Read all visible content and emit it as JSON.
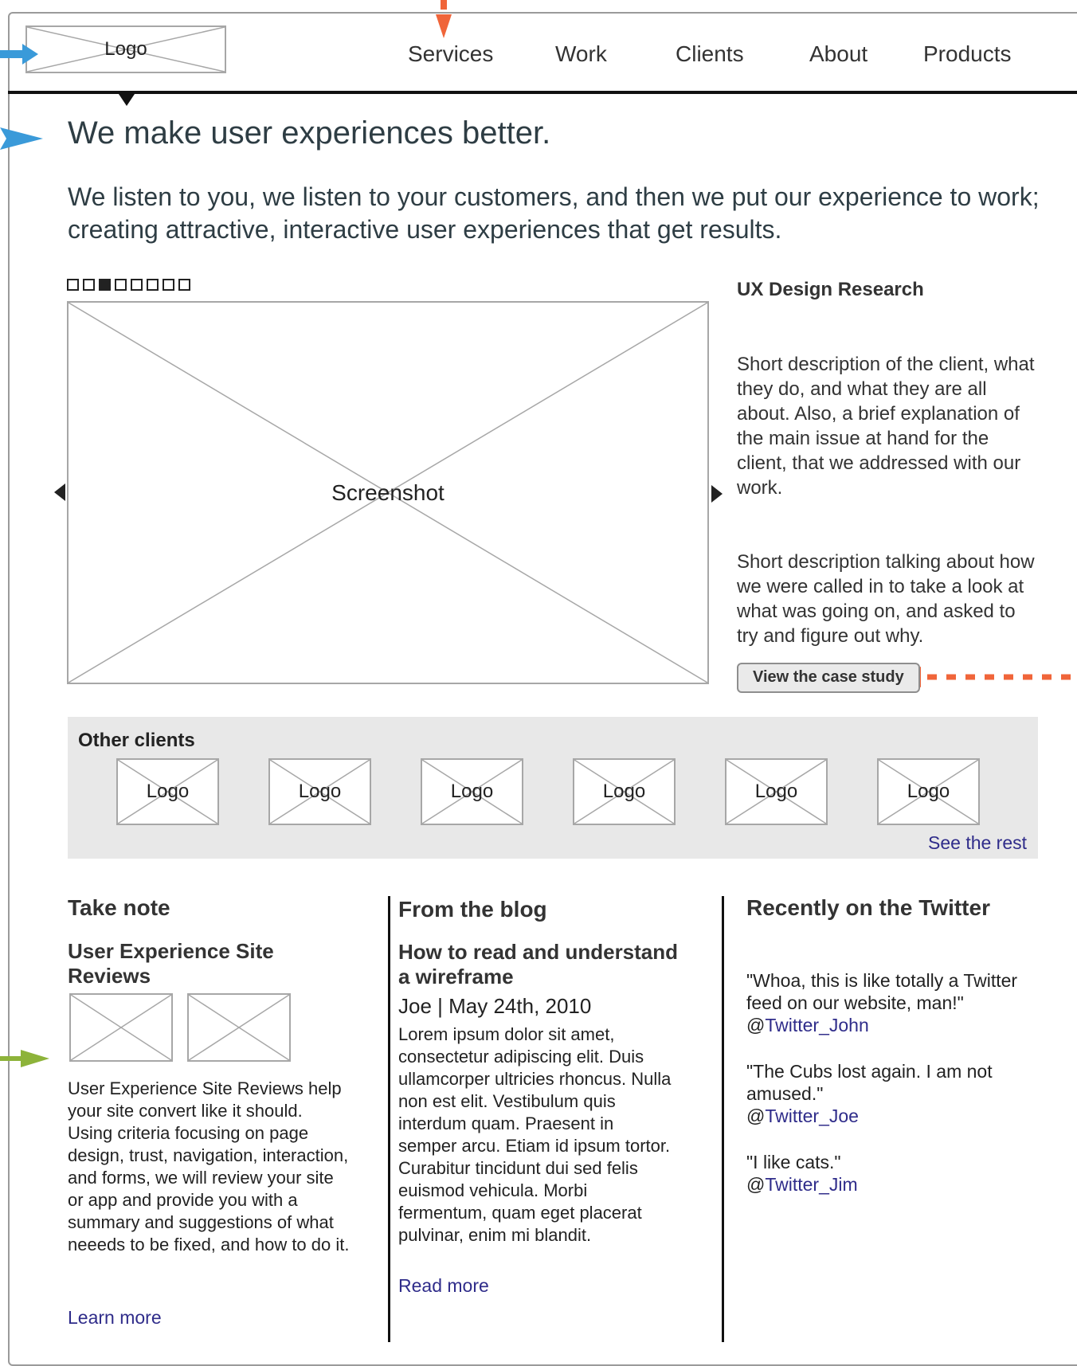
{
  "header": {
    "logo_label": "Logo",
    "nav": [
      "Services",
      "Work",
      "Clients",
      "About",
      "Products"
    ]
  },
  "hero": {
    "title": "We make user experiences better.",
    "intro": "We listen to you, we listen to your customers, and then we put our experience to work; creating attractive, interactive user experiences that get results."
  },
  "carousel": {
    "slide_count": 8,
    "active_index": 2,
    "screenshot_label": "Screenshot"
  },
  "feature": {
    "title": "UX Design Research",
    "description_1": "Short description of the client, what they do, and what they are all about. Also, a brief explanation of the main issue at hand for the client, that we addressed with our work.",
    "description_2": "Short description talking about how we were called in to take a look at what was going on, and asked to try and figure out why.",
    "button_label": "View the case study"
  },
  "other_clients": {
    "title": "Other clients",
    "logos": [
      "Logo",
      "Logo",
      "Logo",
      "Logo",
      "Logo",
      "Logo"
    ],
    "see_rest": "See the rest"
  },
  "take_note": {
    "heading": "Take note",
    "subheading": "User Experience Site Reviews",
    "body": "User Experience Site Reviews help your site convert like it should. Using criteria focusing on page design, trust, navigation, interaction, and forms, we will review your site or app and provide you with a summary and suggestions of what neeeds to be fixed, and how to do it.",
    "link": "Learn more"
  },
  "blog": {
    "heading": "From the blog",
    "post_title": "How to read and understand a wireframe",
    "byline": "Joe | May 24th, 2010",
    "excerpt": "Lorem ipsum dolor sit amet, consectetur adipiscing elit. Duis ullamcorper ultricies rhoncus. Nulla non est elit. Vestibulum quis interdum quam. Praesent in semper arcu. Etiam id ipsum tortor. Curabitur tincidunt dui sed felis euismod vehicula. Morbi fermentum, quam eget placerat pulvinar, enim mi blandit.",
    "link": "Read more"
  },
  "twitter": {
    "heading": "Recently on the Twitter",
    "tweets": [
      {
        "text": "\"Whoa, this is like totally a Twitter feed on our website, man!\"",
        "at": "@",
        "handle": "Twitter_John"
      },
      {
        "text": "\"The Cubs lost again. I am not amused.\"",
        "at": "@",
        "handle": "Twitter_Joe"
      },
      {
        "text": "\"I like cats.\"",
        "at": "@",
        "handle": "Twitter_Jim"
      }
    ]
  },
  "colors": {
    "link": "#2f2c8a",
    "annotation_blue": "#3a9ad9",
    "annotation_orange": "#f0653a",
    "annotation_green": "#8db33a",
    "band_gray": "#e8e8e8"
  }
}
